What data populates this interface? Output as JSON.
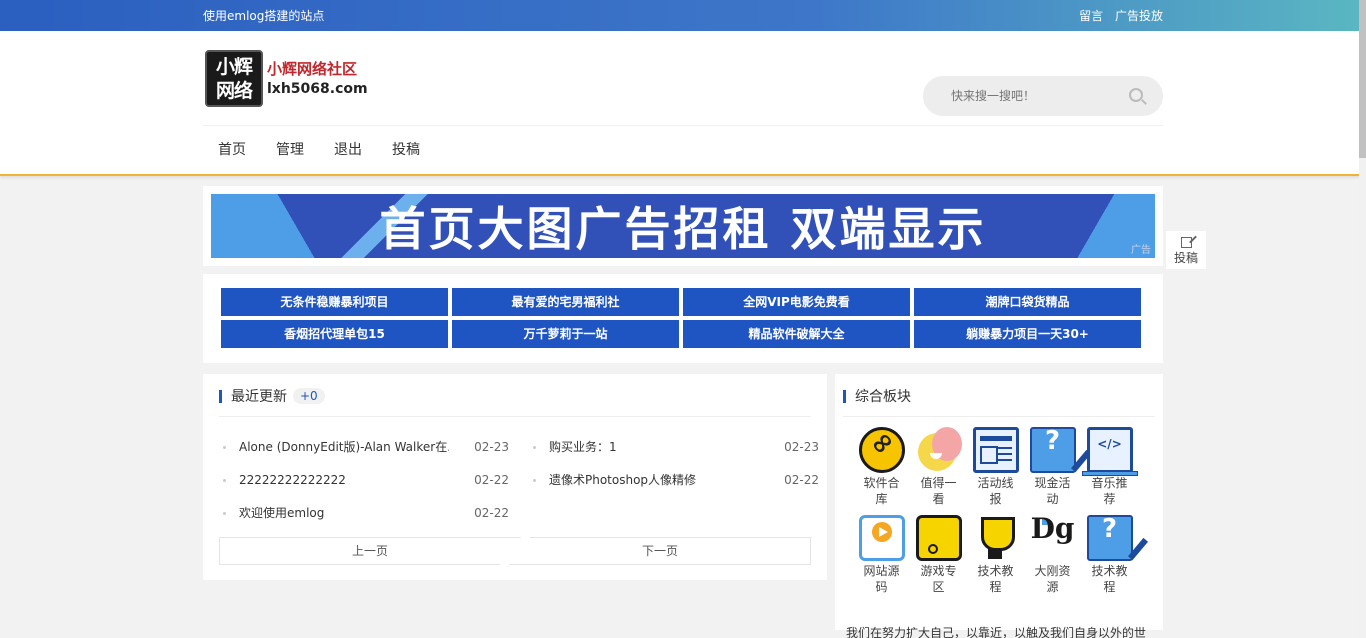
{
  "topbar": {
    "site_tagline": "使用emlog搭建的站点",
    "links": [
      "留言",
      "广告投放"
    ]
  },
  "logo": {
    "mark_line1": "小辉",
    "mark_line2": "网络",
    "name": "小辉网络社区",
    "domain": "lxh5068.com"
  },
  "search": {
    "placeholder": "快来搜一搜吧！"
  },
  "nav": {
    "items": [
      "首页",
      "管理",
      "退出",
      "投稿"
    ],
    "active": "首页"
  },
  "banner": {
    "text": "首页大图广告招租  双端显示",
    "tag": "广告",
    "colors": {
      "base": "#3150b8",
      "accent": "#4d9ee6"
    }
  },
  "ad_links": [
    "无条件稳赚暴利项目",
    "最有爱的宅男福利社",
    "全网VIP电影免费看",
    "潮牌口袋货精品",
    "香烟招代理单包15",
    "万千萝莉于一站",
    "精品软件破解大全",
    "躺赚暴力项目一天30+"
  ],
  "recent": {
    "title": "最近更新",
    "count": "+0",
    "posts": [
      {
        "title": "Alone (DonnyEdit版)-Alan Walker在...",
        "date": "02-23"
      },
      {
        "title": "购买业务：1",
        "date": "02-23"
      },
      {
        "title": "22222222222222",
        "date": "02-22"
      },
      {
        "title": "遗像术Photoshop人像精修",
        "date": "02-22"
      },
      {
        "title": "欢迎使用emlog",
        "date": "02-22"
      }
    ],
    "prev_label": "上一页",
    "next_label": "下一页"
  },
  "forum": {
    "title": "综合板块",
    "boards": [
      {
        "label": "软件合库",
        "icon": "link-icon"
      },
      {
        "label": "值得一看",
        "icon": "face-icon"
      },
      {
        "label": "活动线报",
        "icon": "document-icon"
      },
      {
        "label": "现金活动",
        "icon": "question-icon"
      },
      {
        "label": "音乐推荐",
        "icon": "code-icon"
      },
      {
        "label": "网站源码",
        "icon": "play-icon"
      },
      {
        "label": "游戏专区",
        "icon": "phone-icon"
      },
      {
        "label": "技术教程",
        "icon": "trophy-icon"
      },
      {
        "label": "大刚资源",
        "icon": "dg-logo-icon"
      },
      {
        "label": "技术教程",
        "icon": "question-icon"
      }
    ],
    "description": "我们在努力扩大自己，以靠近，以触及我们自身以外的世"
  },
  "side": {
    "post_label": "投稿"
  },
  "theme": {
    "primary": "#1f55c3",
    "nav_underline": "#f2b233"
  }
}
